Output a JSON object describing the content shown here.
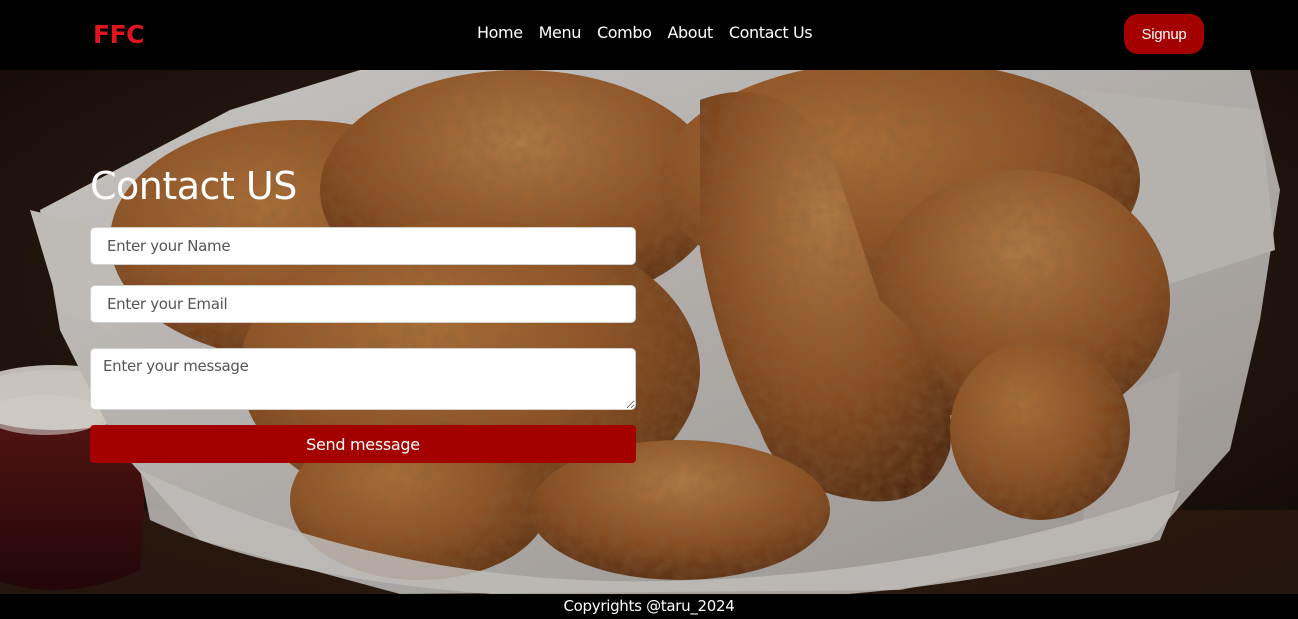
{
  "navbar": {
    "logo": "FFC",
    "links": [
      "Home",
      "Menu",
      "Combo",
      "About",
      "Contact Us"
    ],
    "signup_label": "Signup"
  },
  "hero": {
    "image": "fried-chicken-basket"
  },
  "contact": {
    "title": "Contact US",
    "name_placeholder": "Enter your Name",
    "email_placeholder": "Enter your Email",
    "message_placeholder": "Enter your message",
    "send_label": "Send message"
  },
  "footer": {
    "text": "Copyrights @taru_2024"
  },
  "colors": {
    "brand_red": "#e0141c",
    "button_red": "#a40000",
    "nav_bg": "#000000"
  }
}
